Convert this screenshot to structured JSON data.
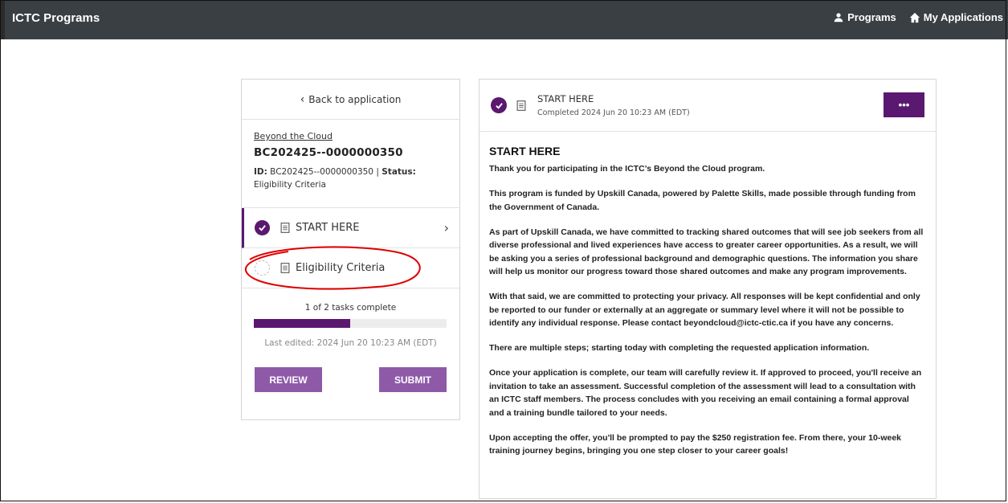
{
  "app": {
    "title": "ICTC Programs"
  },
  "nav": {
    "programs": "Programs",
    "my_applications": "My Applications"
  },
  "left": {
    "back_label": "Back to application",
    "program_link": "Beyond the Cloud",
    "app_code": "BC202425--0000000350",
    "id_label": "ID:",
    "id_value": "BC202425--0000000350",
    "separator": "|",
    "status_label": "Status:",
    "status_value": "Eligibility Criteria",
    "tasks": [
      {
        "label": "START HERE",
        "completed": true
      },
      {
        "label": "Eligibility Criteria",
        "completed": false
      }
    ],
    "progress_text": "1 of 2 tasks complete",
    "progress_fraction": 0.5,
    "last_edited": "Last edited: 2024 Jun 20 10:23 AM (EDT)",
    "review_label": "REVIEW",
    "submit_label": "SUBMIT"
  },
  "right": {
    "header_title": "START HERE",
    "header_sub": "Completed 2024 Jun 20 10:23 AM (EDT)",
    "more_label": "•••",
    "heading": "START HERE",
    "paragraphs": [
      "Thank you for participating in the ICTC’s Beyond the Cloud program.",
      "This program is funded by Upskill Canada, powered by Palette Skills, made possible through funding from the Government of Canada.",
      "As part of Upskill Canada, we have committed to tracking shared outcomes that will see job seekers from all diverse professional and lived experiences have access to greater career opportunities. As a result, we will be asking you a series of professional background and demographic questions. The information you share will help us monitor our progress toward those shared outcomes and make any program improvements.",
      "With that said, we are committed to protecting your privacy. All responses will be kept confidential and only be reported to our funder or externally at an aggregate or summary level where it will not be possible to identify any individual response. Please contact beyondcloud@ictc-ctic.ca if you have any concerns.",
      "There are multiple steps; starting today with completing the requested application information.",
      "Once your application is complete, our team will carefully review it. If approved to proceed, you'll receive an invitation to take an assessment. Successful completion of the assessment will lead to a consultation with an ICTC staff members. The process concludes with you receiving an email containing a formal approval and a training bundle tailored to your needs.",
      "Upon accepting the offer, you'll be prompted to pay the $250 registration fee. From there, your 10-week training journey begins, bringing you one step closer to your career goals!"
    ]
  },
  "colors": {
    "topbar": "#3a3f44",
    "brand_purple": "#5a1870",
    "button_purple": "#8e5aa8",
    "annotation_red": "#e00000"
  }
}
